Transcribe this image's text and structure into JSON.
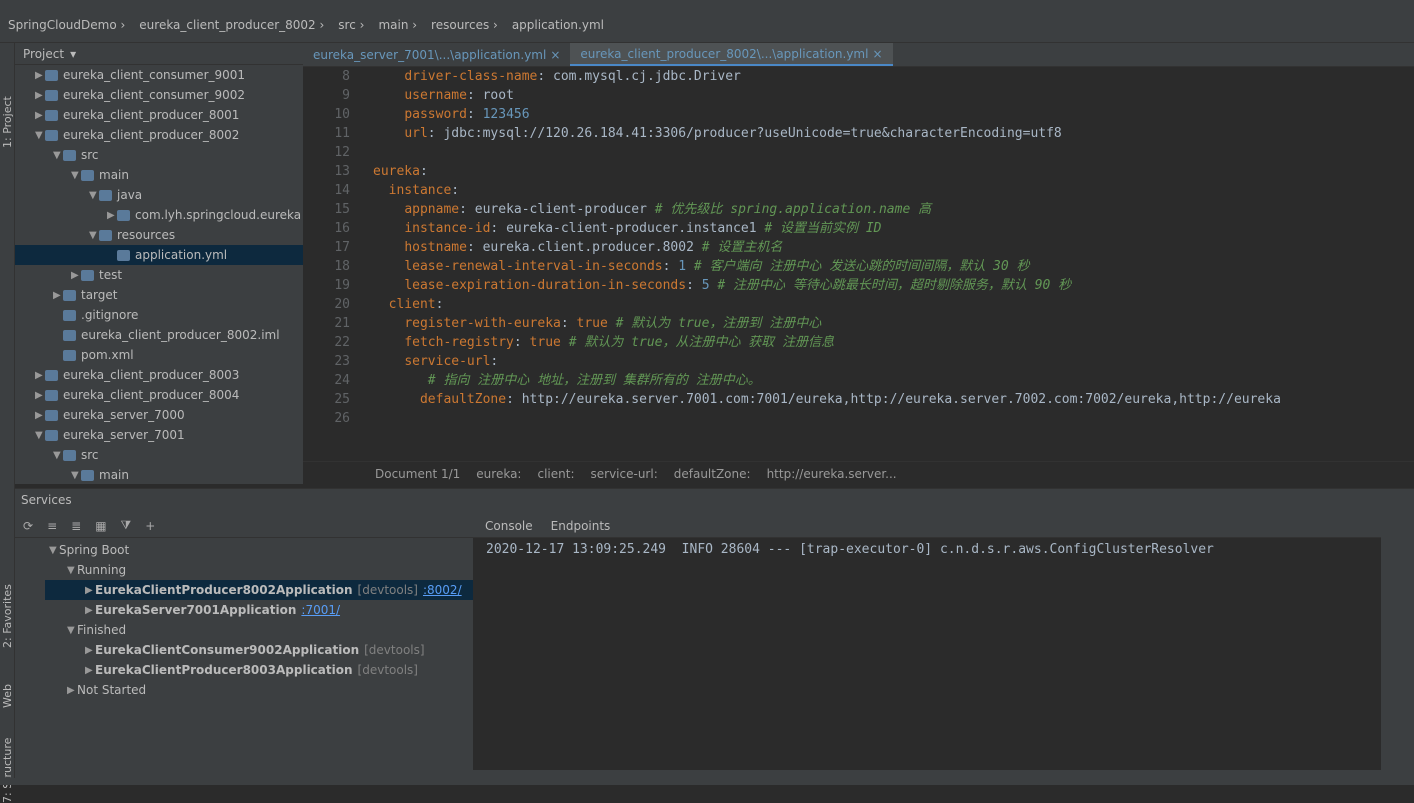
{
  "breadcrumb": [
    "SpringCloudDemo",
    "eureka_client_producer_8002",
    "src",
    "main",
    "resources",
    "application.yml"
  ],
  "sidebar": [
    "1: Project",
    "2: Favorites",
    "Web",
    "7: Structure"
  ],
  "project": {
    "title": "Project",
    "rows": [
      {
        "d": 1,
        "t": "▶",
        "l": "eureka_client_consumer_9001"
      },
      {
        "d": 1,
        "t": "▶",
        "l": "eureka_client_consumer_9002"
      },
      {
        "d": 1,
        "t": "▶",
        "l": "eureka_client_producer_8001"
      },
      {
        "d": 1,
        "t": "▼",
        "l": "eureka_client_producer_8002"
      },
      {
        "d": 2,
        "t": "▼",
        "l": "src"
      },
      {
        "d": 3,
        "t": "▼",
        "l": "main"
      },
      {
        "d": 4,
        "t": "▼",
        "l": "java"
      },
      {
        "d": 5,
        "t": "▶",
        "l": "com.lyh.springcloud.eureka"
      },
      {
        "d": 4,
        "t": "▼",
        "l": "resources"
      },
      {
        "d": 5,
        "t": "",
        "l": "application.yml",
        "sel": true
      },
      {
        "d": 3,
        "t": "▶",
        "l": "test"
      },
      {
        "d": 2,
        "t": "▶",
        "l": "target"
      },
      {
        "d": 2,
        "t": "",
        "l": ".gitignore"
      },
      {
        "d": 2,
        "t": "",
        "l": "eureka_client_producer_8002.iml"
      },
      {
        "d": 2,
        "t": "",
        "l": "pom.xml"
      },
      {
        "d": 1,
        "t": "▶",
        "l": "eureka_client_producer_8003"
      },
      {
        "d": 1,
        "t": "▶",
        "l": "eureka_client_producer_8004"
      },
      {
        "d": 1,
        "t": "▶",
        "l": "eureka_server_7000"
      },
      {
        "d": 1,
        "t": "▼",
        "l": "eureka_server_7001"
      },
      {
        "d": 2,
        "t": "▼",
        "l": "src"
      },
      {
        "d": 3,
        "t": "▼",
        "l": "main"
      }
    ]
  },
  "tabs": [
    "eureka_server_7001\\...\\application.yml",
    "eureka_client_producer_8002\\...\\application.yml"
  ],
  "code": [
    {
      "n": "8",
      "i": "    ",
      "k": "driver-class-name",
      "v": "com.mysql.cj.jdbc.Driver"
    },
    {
      "n": "9",
      "i": "    ",
      "k": "username",
      "v": "root"
    },
    {
      "n": "10",
      "i": "    ",
      "k": "password",
      "v": "123456"
    },
    {
      "n": "11",
      "i": "    ",
      "k": "url",
      "v": "jdbc:mysql://120.26.184.41:3306/producer?useUnicode=true&characterEncoding=utf8"
    },
    {
      "n": "12"
    },
    {
      "n": "13",
      "i": "",
      "k": "eureka"
    },
    {
      "n": "14",
      "i": "  ",
      "k": "instance"
    },
    {
      "n": "15",
      "i": "    ",
      "k": "appname",
      "v": "eureka-client-producer",
      "c": "# 优先级比 spring.application.name 高"
    },
    {
      "n": "16",
      "i": "    ",
      "k": "instance-id",
      "v": "eureka-client-producer.instance1",
      "c": "# 设置当前实例 ID"
    },
    {
      "n": "17",
      "i": "    ",
      "k": "hostname",
      "v": "eureka.client.producer.8002",
      "c": "# 设置主机名"
    },
    {
      "n": "18",
      "i": "    ",
      "k": "lease-renewal-interval-in-seconds",
      "v": "1",
      "c": "# 客户端向 注册中心 发送心跳的时间间隔，默认 30 秒"
    },
    {
      "n": "19",
      "i": "    ",
      "k": "lease-expiration-duration-in-seconds",
      "v": "5",
      "c": "# 注册中心 等待心跳最长时间，超时剔除服务，默认 90 秒"
    },
    {
      "n": "20",
      "i": "  ",
      "k": "client"
    },
    {
      "n": "21",
      "i": "    ",
      "k": "register-with-eureka",
      "v": "true",
      "c": "# 默认为 true，注册到 注册中心"
    },
    {
      "n": "22",
      "i": "    ",
      "k": "fetch-registry",
      "v": "true",
      "c": "# 默认为 true，从注册中心 获取 注册信息"
    },
    {
      "n": "23",
      "i": "    ",
      "k": "service-url"
    },
    {
      "n": "24",
      "i": "      ",
      "c": "# 指向 注册中心 地址，注册到 集群所有的 注册中心。"
    },
    {
      "n": "25",
      "i": "      ",
      "k": "defaultZone",
      "v": "http://eureka.server.7001.com:7001/eureka,http://eureka.server.7002.com:7002/eureka,http://eureka"
    },
    {
      "n": "26"
    }
  ],
  "editor_path": [
    "Document 1/1",
    "eureka:",
    "client:",
    "service-url:",
    "defaultZone:",
    "http://eureka.server..."
  ],
  "services": {
    "title": "Services",
    "tree": [
      {
        "d": 0,
        "t": "▼",
        "l": "Spring Boot"
      },
      {
        "d": 1,
        "t": "▼",
        "l": "Running"
      },
      {
        "d": 2,
        "l": "EurekaClientProducer8002Application",
        "x": "[devtools]",
        "p": ":8002/",
        "sel": true
      },
      {
        "d": 2,
        "l": "EurekaServer7001Application",
        "p": ":7001/"
      },
      {
        "d": 1,
        "t": "▼",
        "l": "Finished"
      },
      {
        "d": 2,
        "l": "EurekaClientConsumer9002Application",
        "x": "[devtools]"
      },
      {
        "d": 2,
        "l": "EurekaClientProducer8003Application",
        "x": "[devtools]"
      },
      {
        "d": 1,
        "t": "▶",
        "l": "Not Started"
      }
    ]
  },
  "console": {
    "tabs": [
      "Console",
      "Endpoints"
    ],
    "line": "2020-12-17 13:09:25.249  INFO 28604 --- [trap-executor-0] c.n.d.s.r.aws.ConfigClusterResolver"
  }
}
